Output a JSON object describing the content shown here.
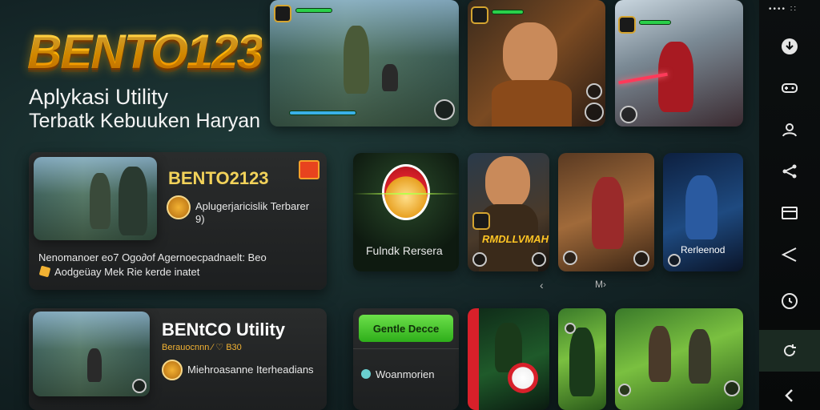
{
  "brand": {
    "logo": "BENTO123",
    "tagline_1": "Aplykasi Utility",
    "tagline_2": "Terbatk Kebuuken Haryan"
  },
  "feature_card": {
    "title": "BENTO2123",
    "subtitle": "Aplugerjaricislik Terbarer",
    "subtitle_2": "9)",
    "desc": "Nenomanoer eo7 Ogo∂of Agernoecpadnaelt: Beo",
    "note": "Aodgeüay Mek Rie kerde inatet",
    "badge_color": "#e8431e"
  },
  "utility_card": {
    "title": "BENtCO Utility",
    "meta": "Berauocnnn  ∕ ♡ B30",
    "desc": "Miehroasanne Iterheadians"
  },
  "promo_tiles": {
    "mascot_label": "Fulndk Rersera",
    "character_banner": "RMDLLVMAH",
    "blue_label": "Rerleenod"
  },
  "pager": {
    "prev": "‹",
    "next": "M›"
  },
  "mini_panel": {
    "button_label": "Gentle Decce",
    "item_label": "Woanmorien"
  },
  "sidebar": {
    "top_text": "••••  ∶∶",
    "items": [
      {
        "name": "download-icon"
      },
      {
        "name": "gamepad-icon"
      },
      {
        "name": "user-icon"
      },
      {
        "name": "share-icon"
      },
      {
        "name": "card-icon"
      },
      {
        "name": "send-icon"
      },
      {
        "name": "compass-icon"
      },
      {
        "name": "refresh-icon"
      },
      {
        "name": "back-icon"
      }
    ]
  },
  "colors": {
    "accent_gold": "#ffc524",
    "accent_green": "#2eae1a",
    "bg_dark": "#132325"
  }
}
